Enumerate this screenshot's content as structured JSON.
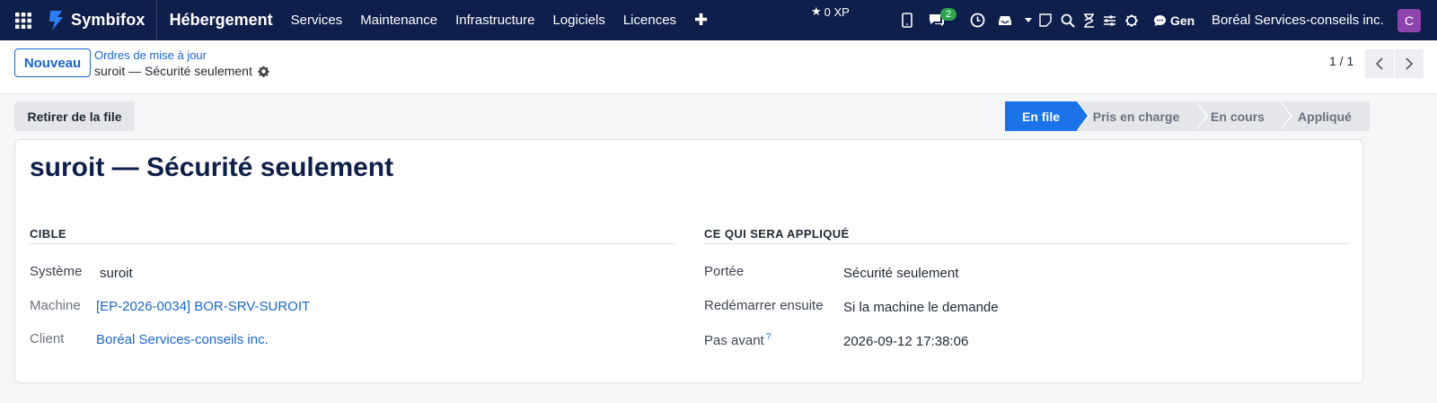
{
  "topbar": {
    "brand": "Symbifox",
    "app_title": "Hébergement",
    "menu": [
      "Services",
      "Maintenance",
      "Infrastructure",
      "Logiciels",
      "Licences"
    ],
    "xp": "0 XP",
    "messages_count": "2",
    "gen": "Gen",
    "company": "Boréal Services-conseils inc.",
    "avatar_letter": "C"
  },
  "control": {
    "new_label": "Nouveau",
    "breadcrumb_parent": "Ordres de mise à jour",
    "breadcrumb_current": "suroit — Sécurité seulement",
    "pager": "1 / 1"
  },
  "status": {
    "dequeue_label": "Retirer de la file",
    "stages": [
      {
        "label": "En file",
        "active": true
      },
      {
        "label": "Pris en charge",
        "active": false
      },
      {
        "label": "En cours",
        "active": false
      },
      {
        "label": "Appliqué",
        "active": false
      }
    ]
  },
  "record": {
    "title": "suroit — Sécurité seulement",
    "target": {
      "heading": "CIBLE",
      "system_label": "Système",
      "system_value": "suroit",
      "machine_label": "Machine",
      "machine_value": "[EP-2026-0034] BOR-SRV-SUROIT",
      "client_label": "Client",
      "client_value": "Boréal Services-conseils inc."
    },
    "applied": {
      "heading": "CE QUI SERA APPLIQUÉ",
      "scope_label": "Portée",
      "scope_value": "Sécurité seulement",
      "reboot_label": "Redémarrer ensuite",
      "reboot_value": "Si la machine le demande",
      "notbefore_label": "Pas avant",
      "notbefore_help": "?",
      "notbefore_value": "2026-09-12 17:38:06"
    }
  },
  "colors": {
    "navbar": "#0f1f4b",
    "accent": "#1a73e8",
    "link": "#1a66cc",
    "badge": "#2ea44f",
    "avatar": "#8e44ad"
  }
}
